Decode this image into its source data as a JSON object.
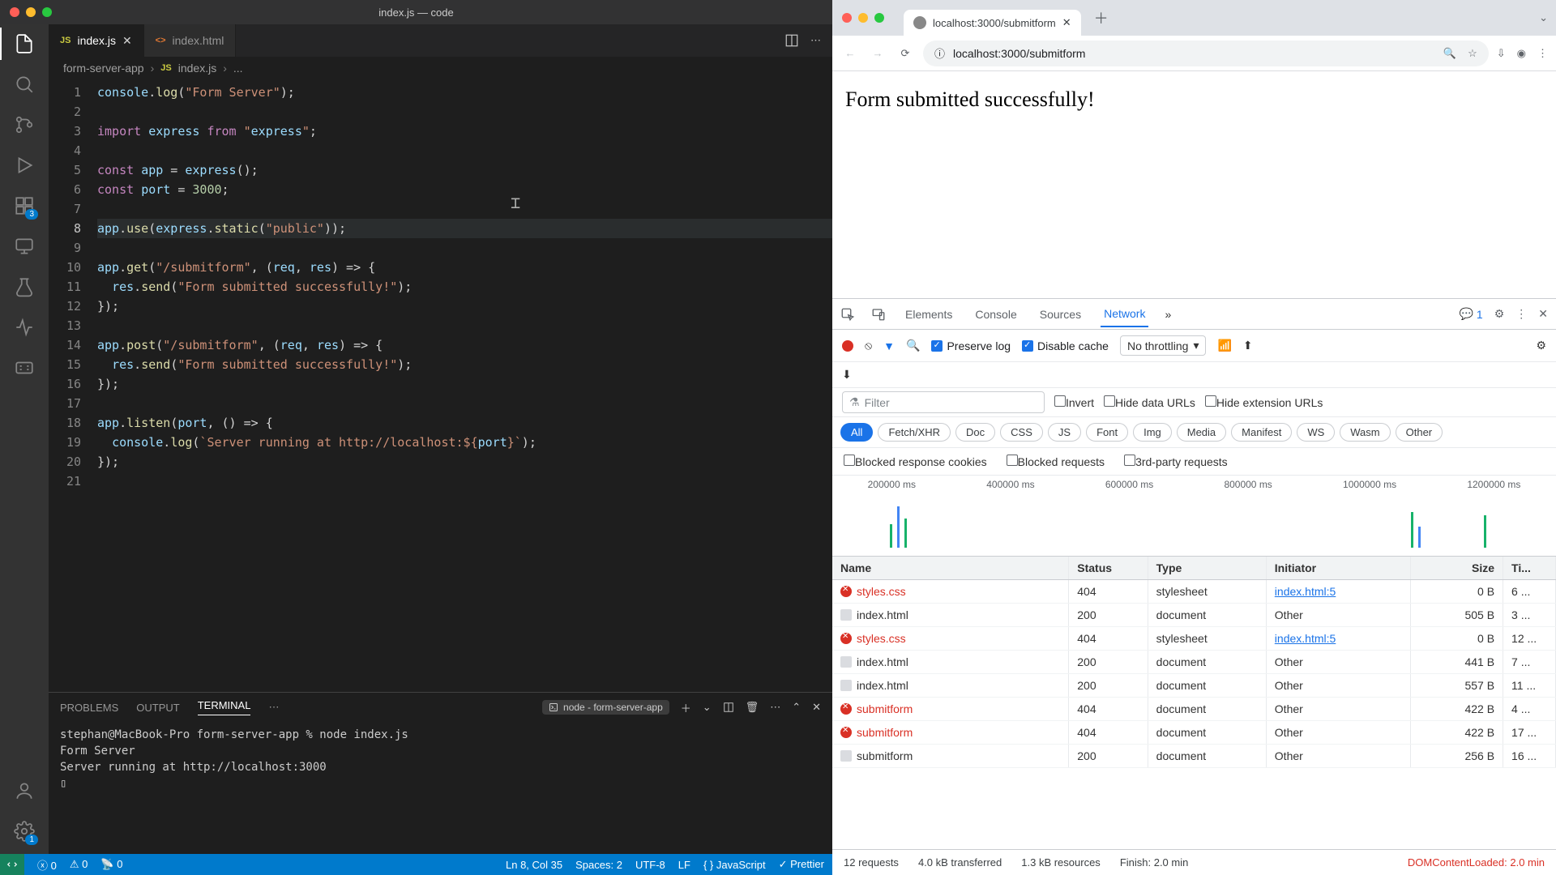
{
  "vscode": {
    "title": "index.js — code",
    "tabs": [
      {
        "icon": "JS",
        "label": "index.js",
        "active": true,
        "dirty": false
      },
      {
        "icon": "<>",
        "label": "index.html",
        "active": false
      }
    ],
    "breadcrumb": {
      "root": "form-server-app",
      "file": "index.js",
      "tail": "..."
    },
    "activity_badges": {
      "ext": "3",
      "gear": "1"
    },
    "code_lines": [
      "console.log(\"Form Server\");",
      "",
      "import express from \"express\";",
      "",
      "const app = express();",
      "const port = 3000;",
      "",
      "app.use(express.static(\"public\"));",
      "",
      "app.get(\"/submitform\", (req, res) => {",
      "  res.send(\"Form submitted successfully!\");",
      "});",
      "",
      "app.post(\"/submitform\", (req, res) => {",
      "  res.send(\"Form submitted successfully!\");",
      "});",
      "",
      "app.listen(port, () => {",
      "  console.log(`Server running at http://localhost:${port}`);",
      "});",
      ""
    ],
    "active_line": 8,
    "panel": {
      "tabs": {
        "problems": "PROBLEMS",
        "output": "OUTPUT",
        "terminal": "TERMINAL"
      },
      "term_label": "node - form-server-app",
      "terminal_text": "stephan@MacBook-Pro form-server-app % node index.js\nForm Server\nServer running at http://localhost:3000\n▯"
    },
    "statusbar": {
      "errors": "0",
      "warnings": "0",
      "ports": "0",
      "cursor": "Ln 8, Col 35",
      "spaces": "Spaces: 2",
      "enc": "UTF-8",
      "eol": "LF",
      "lang": "JavaScript",
      "prettier": "Prettier"
    }
  },
  "chrome": {
    "tab_title": "localhost:3000/submitform",
    "url": "localhost:3000/submitform",
    "page_text": "Form submitted successfully!",
    "devtools": {
      "tabs": [
        "Elements",
        "Console",
        "Sources",
        "Network"
      ],
      "active_tab": "Network",
      "msg_count": "1",
      "toolbar": {
        "preserve_log": "Preserve log",
        "disable_cache": "Disable cache",
        "throttling": "No throttling"
      },
      "filter_placeholder": "Filter",
      "filter_opts": {
        "invert": "Invert",
        "hide_data": "Hide data URLs",
        "hide_ext": "Hide extension URLs"
      },
      "pills": [
        "All",
        "Fetch/XHR",
        "Doc",
        "CSS",
        "JS",
        "Font",
        "Img",
        "Media",
        "Manifest",
        "WS",
        "Wasm",
        "Other"
      ],
      "checks": {
        "cookies": "Blocked response cookies",
        "blocked": "Blocked requests",
        "third": "3rd-party requests"
      },
      "timeline_ticks": [
        "200000 ms",
        "400000 ms",
        "600000 ms",
        "800000 ms",
        "1000000 ms",
        "1200000 ms"
      ],
      "columns": {
        "name": "Name",
        "status": "Status",
        "type": "Type",
        "initiator": "Initiator",
        "size": "Size",
        "time": "Ti..."
      },
      "rows": [
        {
          "name": "styles.css",
          "status": "404",
          "type": "stylesheet",
          "initiator": "index.html:5",
          "size": "0 B",
          "time": "6 ...",
          "err": true,
          "link": true
        },
        {
          "name": "index.html",
          "status": "200",
          "type": "document",
          "initiator": "Other",
          "size": "505 B",
          "time": "3 ...",
          "err": false
        },
        {
          "name": "styles.css",
          "status": "404",
          "type": "stylesheet",
          "initiator": "index.html:5",
          "size": "0 B",
          "time": "12 ...",
          "err": true,
          "link": true
        },
        {
          "name": "index.html",
          "status": "200",
          "type": "document",
          "initiator": "Other",
          "size": "441 B",
          "time": "7 ...",
          "err": false
        },
        {
          "name": "index.html",
          "status": "200",
          "type": "document",
          "initiator": "Other",
          "size": "557 B",
          "time": "11 ...",
          "err": false
        },
        {
          "name": "submitform",
          "status": "404",
          "type": "document",
          "initiator": "Other",
          "size": "422 B",
          "time": "4 ...",
          "err": true
        },
        {
          "name": "submitform",
          "status": "404",
          "type": "document",
          "initiator": "Other",
          "size": "422 B",
          "time": "17 ...",
          "err": true
        },
        {
          "name": "submitform",
          "status": "200",
          "type": "document",
          "initiator": "Other",
          "size": "256 B",
          "time": "16 ...",
          "err": false
        }
      ],
      "status": {
        "requests": "12 requests",
        "transferred": "4.0 kB transferred",
        "resources": "1.3 kB resources",
        "finish": "Finish: 2.0 min",
        "dcl": "DOMContentLoaded: 2.0 min"
      }
    }
  }
}
